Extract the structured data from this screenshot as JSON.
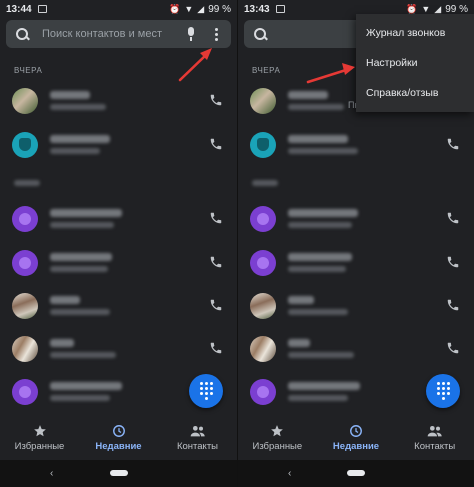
{
  "left_screen": {
    "status": {
      "time": "13:44",
      "battery": "99 %"
    },
    "search": {
      "placeholder": "Поиск контактов и мест"
    },
    "section_label": "ВЧЕРА",
    "nav": [
      {
        "label": "Избранные"
      },
      {
        "label": "Недавние"
      },
      {
        "label": "Контакты"
      }
    ]
  },
  "right_screen": {
    "status": {
      "time": "13:43",
      "battery": "99 %"
    },
    "section_label": "ВЧЕРА",
    "partial_call_suffix": "Пн",
    "menu": {
      "items": [
        {
          "label": "Журнал звонков"
        },
        {
          "label": "Настройки"
        },
        {
          "label": "Справка/отзыв"
        }
      ]
    },
    "nav": [
      {
        "label": "Избранные"
      },
      {
        "label": "Недавние"
      },
      {
        "label": "Контакты"
      }
    ]
  },
  "colors": {
    "background": "#202124",
    "accent": "#8ab4f8",
    "fab": "#1a73e8",
    "avatar_purple": "#7b3fd1",
    "avatar_teal": "#1aa3b8",
    "arrow": "#e53935"
  },
  "icons": {
    "search": "search-icon",
    "mic": "mic-icon",
    "more": "more-vert-icon",
    "call": "phone-icon",
    "dialpad": "dialpad-icon",
    "favorites": "star-icon",
    "recents": "clock-icon",
    "contacts": "people-icon"
  }
}
